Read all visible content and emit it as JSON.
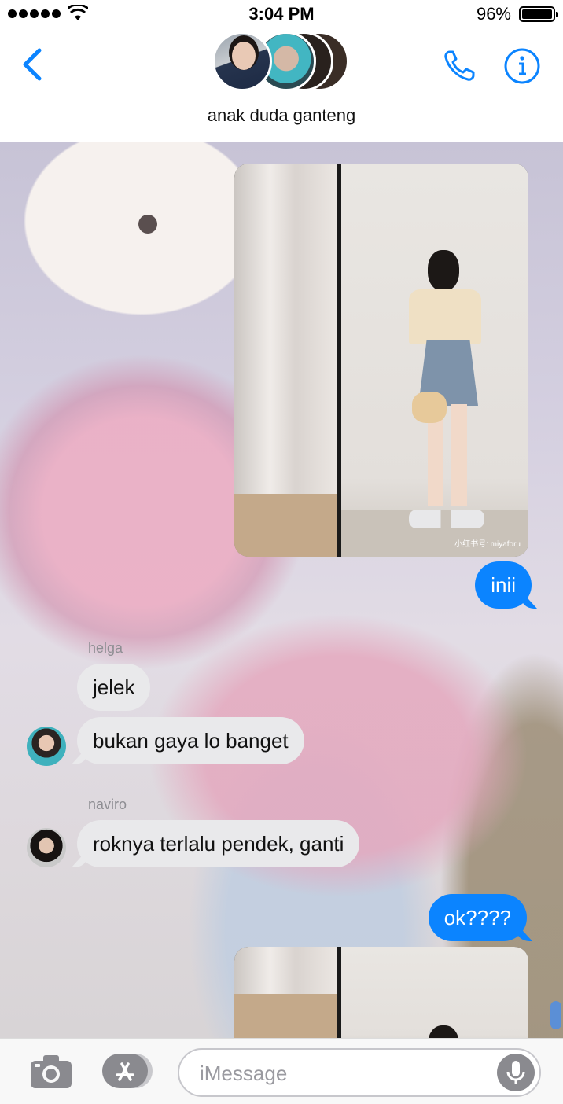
{
  "status_bar": {
    "time": "3:04 PM",
    "battery_percent": "96%",
    "battery_level": 0.96,
    "signal_bars": 5,
    "icons": [
      "signal-dots-icon",
      "wifi-icon",
      "battery-icon"
    ]
  },
  "header": {
    "group_name": "anak duda ganteng",
    "icons": [
      "back-chevron-icon",
      "phone-icon",
      "info-icon"
    ]
  },
  "messages": [
    {
      "type": "image",
      "direction": "outgoing",
      "watermark": "小红书号: miyaforu"
    },
    {
      "type": "text",
      "direction": "outgoing",
      "text": "inii"
    },
    {
      "type": "text",
      "direction": "incoming",
      "sender": "helga",
      "text": "jelek"
    },
    {
      "type": "text",
      "direction": "incoming",
      "sender": "helga",
      "text": "bukan gaya lo banget"
    },
    {
      "type": "text",
      "direction": "incoming",
      "sender": "naviro",
      "text": "roknya terlalu pendek, ganti"
    },
    {
      "type": "text",
      "direction": "outgoing",
      "text": "ok????"
    },
    {
      "type": "image",
      "direction": "outgoing"
    }
  ],
  "input_bar": {
    "placeholder": "iMessage",
    "value": "",
    "icons": [
      "camera-icon",
      "app-store-icon",
      "microphone-icon"
    ]
  },
  "colors": {
    "accent": "#0b84ff",
    "incoming_bubble": "#e9e9eb",
    "sender_label": "#8e8e93"
  }
}
